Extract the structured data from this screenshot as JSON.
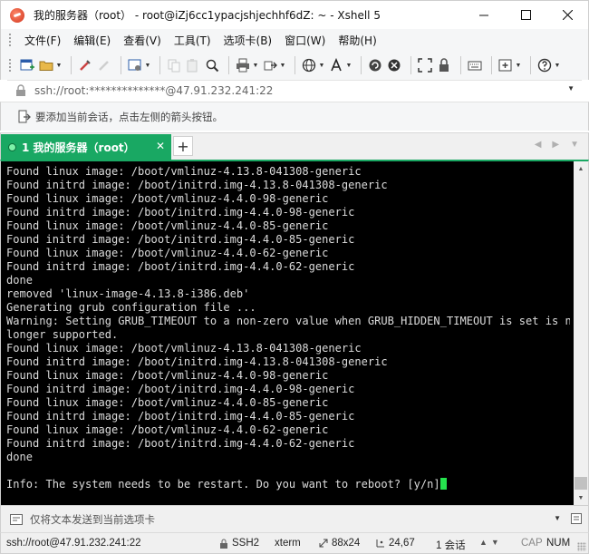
{
  "window": {
    "title": "我的服务器（root） - root@iZj6cc1ypacjshjechhf6dZ: ~ - Xshell 5",
    "controls": {
      "minimize": "—",
      "maximize": "☐",
      "close": "✕"
    }
  },
  "menu": {
    "items": [
      "文件(F)",
      "编辑(E)",
      "查看(V)",
      "工具(T)",
      "选项卡(B)",
      "窗口(W)",
      "帮助(H)"
    ]
  },
  "address": {
    "value": "ssh://root:**************@47.91.232.241:22"
  },
  "hint": {
    "text": "要添加当前会话，点击左侧的箭头按钮。"
  },
  "tabs": {
    "active_label": "1 我的服务器（root）",
    "close": "✕",
    "add": "+"
  },
  "terminal": {
    "lines": [
      "Found linux image: /boot/vmlinuz-4.13.8-041308-generic",
      "Found initrd image: /boot/initrd.img-4.13.8-041308-generic",
      "Found linux image: /boot/vmlinuz-4.4.0-98-generic",
      "Found initrd image: /boot/initrd.img-4.4.0-98-generic",
      "Found linux image: /boot/vmlinuz-4.4.0-85-generic",
      "Found initrd image: /boot/initrd.img-4.4.0-85-generic",
      "Found linux image: /boot/vmlinuz-4.4.0-62-generic",
      "Found initrd image: /boot/initrd.img-4.4.0-62-generic",
      "done",
      "removed 'linux-image-4.13.8-i386.deb'",
      "Generating grub configuration file ...",
      "Warning: Setting GRUB_TIMEOUT to a non-zero value when GRUB_HIDDEN_TIMEOUT is set is no",
      "longer supported.",
      "Found linux image: /boot/vmlinuz-4.13.8-041308-generic",
      "Found initrd image: /boot/initrd.img-4.13.8-041308-generic",
      "Found linux image: /boot/vmlinuz-4.4.0-98-generic",
      "Found initrd image: /boot/initrd.img-4.4.0-98-generic",
      "Found linux image: /boot/vmlinuz-4.4.0-85-generic",
      "Found initrd image: /boot/initrd.img-4.4.0-85-generic",
      "Found linux image: /boot/vmlinuz-4.4.0-62-generic",
      "Found initrd image: /boot/initrd.img-4.4.0-62-generic",
      "done",
      "",
      "Info: The system needs to be restart. Do you want to reboot? [y/n]"
    ],
    "colors": {
      "background": "#000000",
      "foreground": "#dcdcdc",
      "cursor": "#25e44e"
    }
  },
  "compose": {
    "placeholder": "仅将文本发送到当前选项卡"
  },
  "status": {
    "connection": "ssh://root@47.91.232.241:22",
    "protocol": "SSH2",
    "terminal_type": "xterm",
    "size": "88x24",
    "cursor_pos": "24,67",
    "sessions": "1 会话",
    "cap": "CAP",
    "num": "NUM"
  },
  "colors": {
    "accent_tab": "#19a863",
    "chrome": "#f5f6f7"
  },
  "icons": {
    "toolbar": [
      "new-session-icon",
      "open-folder-icon",
      "reconnect-icon",
      "disconnect-icon",
      "properties-icon",
      "copy-icon",
      "paste-icon",
      "find-icon",
      "print-icon",
      "transfer-icon",
      "globe-icon",
      "font-icon",
      "xftp-icon",
      "xmanager-icon",
      "fullscreen-icon",
      "lock-icon",
      "keyboard-icon",
      "add-tab-icon",
      "help-icon"
    ]
  }
}
